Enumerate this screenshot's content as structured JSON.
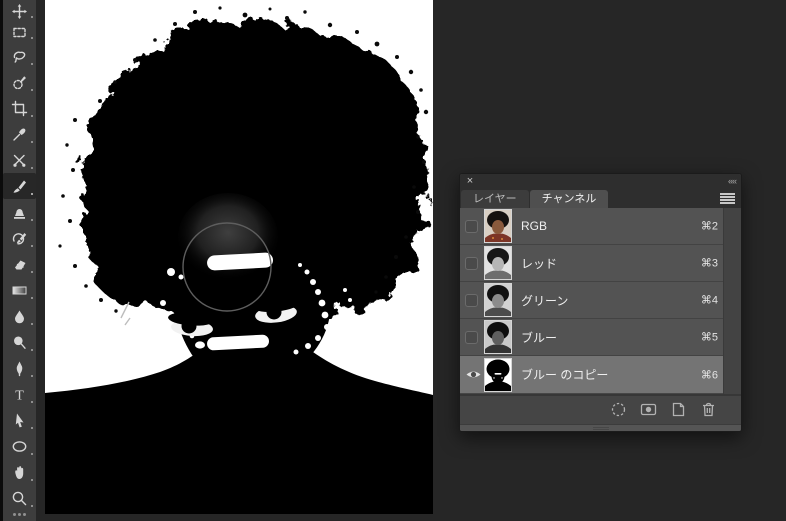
{
  "app": "photoshop-workspace",
  "workspace": {
    "pasteboard_color": "#262626",
    "toolbar_color": "#3d3d3d",
    "canvas_color": "#ffffff"
  },
  "toolbar": {
    "selected_tool": "brush-tool",
    "tools": [
      "move-tool",
      "marquee-tool",
      "lasso-tool",
      "quick-selection-tool",
      "crop-tool",
      "eyedropper-tool",
      "healing-brush-tool",
      "brush-tool",
      "clone-stamp-tool",
      "history-brush-tool",
      "eraser-tool",
      "gradient-tool",
      "blur-tool",
      "dodge-tool",
      "pen-tool",
      "type-tool",
      "path-selection-tool",
      "ellipse-tool",
      "hand-tool",
      "zoom-tool"
    ]
  },
  "canvas": {
    "description": "high-contrast black and white portrait with afro hair, white face-paint dots, white forehead stripe, round brush cursor over forehead"
  },
  "panel": {
    "close_glyph": "×",
    "collapse_glyph": "««",
    "tabs": [
      {
        "label": "レイヤー",
        "active": false
      },
      {
        "label": "チャンネル",
        "active": true
      }
    ],
    "channels": [
      {
        "label": "RGB",
        "shortcut": "⌘2",
        "visible": false,
        "selected": false,
        "thumb": "color"
      },
      {
        "label": "レッド",
        "shortcut": "⌘3",
        "visible": false,
        "selected": false,
        "thumb": "red-channel"
      },
      {
        "label": "グリーン",
        "shortcut": "⌘4",
        "visible": false,
        "selected": false,
        "thumb": "green-channel"
      },
      {
        "label": "ブルー",
        "shortcut": "⌘5",
        "visible": false,
        "selected": false,
        "thumb": "blue-channel"
      },
      {
        "label": "ブルー のコピー",
        "shortcut": "⌘6",
        "visible": true,
        "selected": true,
        "thumb": "blue-copy-channel"
      }
    ],
    "footer_icons": [
      "load-channel-as-selection-icon",
      "save-selection-as-channel-icon",
      "new-channel-icon",
      "delete-channel-icon"
    ]
  }
}
